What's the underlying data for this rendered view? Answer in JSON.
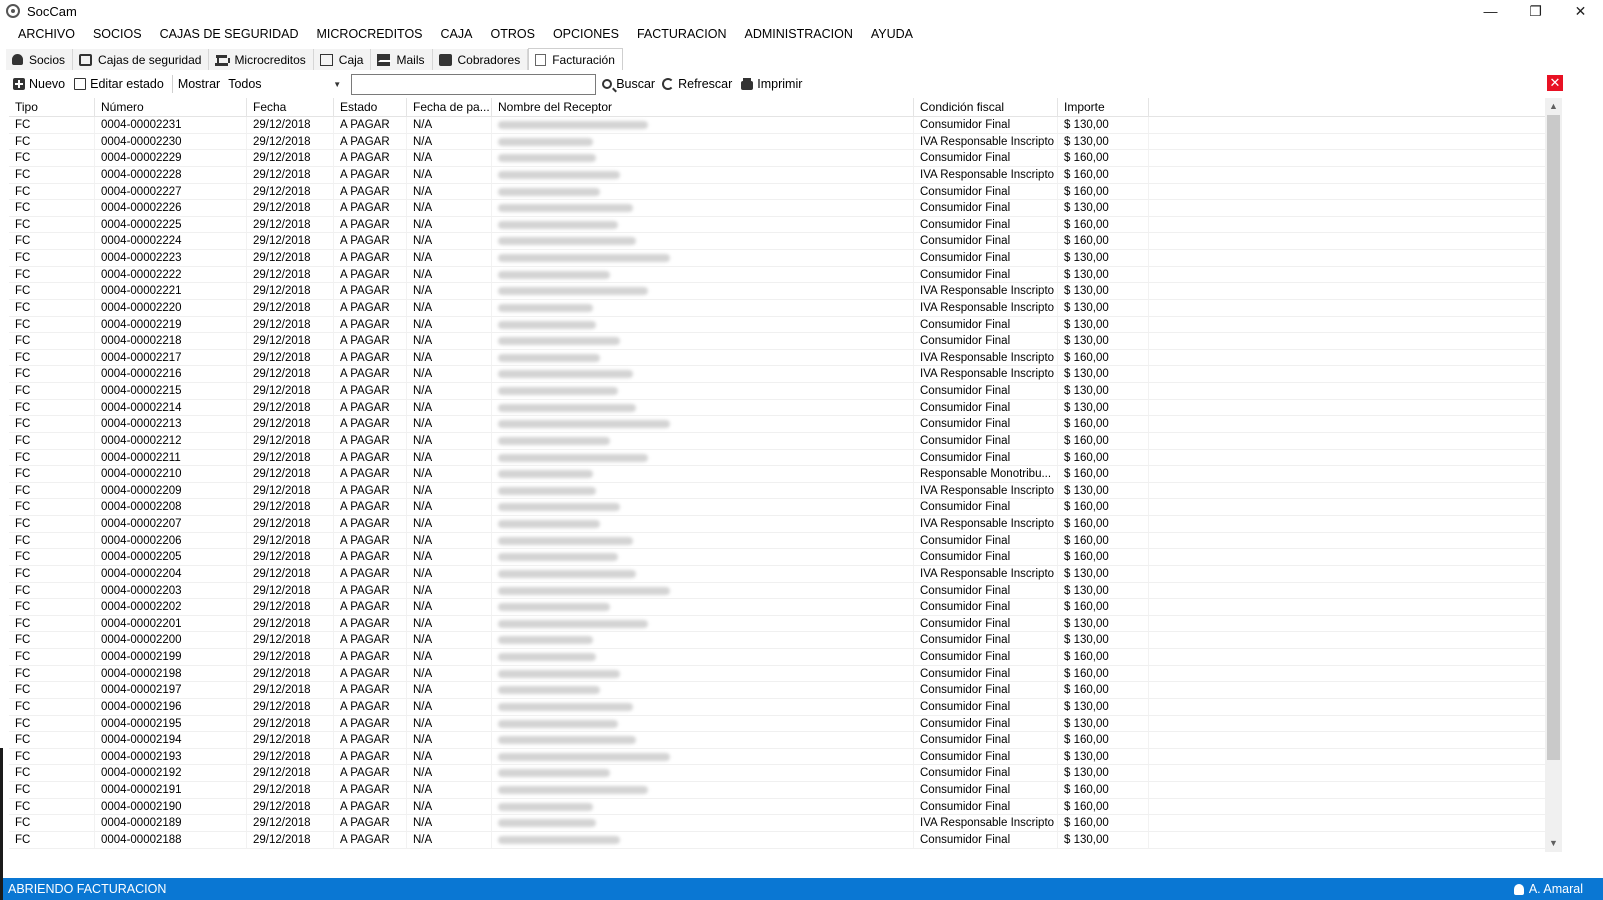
{
  "window": {
    "title": "SocCam",
    "minimize": "—",
    "maximize": "❐",
    "close": "✕"
  },
  "menu": [
    "ARCHIVO",
    "SOCIOS",
    "CAJAS DE SEGURIDAD",
    "MICROCREDITOS",
    "CAJA",
    "OTROS",
    "OPCIONES",
    "FACTURACION",
    "ADMINISTRACION",
    "AYUDA"
  ],
  "tabs": [
    {
      "label": "Socios",
      "icon": "user-icon"
    },
    {
      "label": "Cajas de seguridad",
      "icon": "safe-icon"
    },
    {
      "label": "Microcreditos",
      "icon": "bank-icon"
    },
    {
      "label": "Caja",
      "icon": "cash-icon"
    },
    {
      "label": "Mails",
      "icon": "mail-icon"
    },
    {
      "label": "Cobradores",
      "icon": "briefcase-icon"
    },
    {
      "label": "Facturación",
      "icon": "invoice-icon",
      "active": true
    }
  ],
  "toolbar": {
    "new_label": "Nuevo",
    "edit_state_label": "Editar estado",
    "show_label": "Mostrar",
    "filter_value": "Todos",
    "search_value": "",
    "search_label": "Buscar",
    "refresh_label": "Refrescar",
    "print_label": "Imprimir",
    "close_label": "✕"
  },
  "table": {
    "columns": [
      "Tipo",
      "Número",
      "Fecha",
      "Estado",
      "Fecha de pa...",
      "Nombre del Receptor",
      "Condición fiscal",
      "Importe"
    ],
    "rows": [
      [
        "FC",
        "0004-00002231",
        "29/12/2018",
        "A PAGAR",
        "N/A",
        "",
        "Consumidor Final",
        "$ 130,00"
      ],
      [
        "FC",
        "0004-00002230",
        "29/12/2018",
        "A PAGAR",
        "N/A",
        "",
        "IVA Responsable Inscripto",
        "$ 130,00"
      ],
      [
        "FC",
        "0004-00002229",
        "29/12/2018",
        "A PAGAR",
        "N/A",
        "",
        "Consumidor Final",
        "$ 160,00"
      ],
      [
        "FC",
        "0004-00002228",
        "29/12/2018",
        "A PAGAR",
        "N/A",
        "",
        "IVA Responsable Inscripto",
        "$ 160,00"
      ],
      [
        "FC",
        "0004-00002227",
        "29/12/2018",
        "A PAGAR",
        "N/A",
        "",
        "Consumidor Final",
        "$ 160,00"
      ],
      [
        "FC",
        "0004-00002226",
        "29/12/2018",
        "A PAGAR",
        "N/A",
        "",
        "Consumidor Final",
        "$ 130,00"
      ],
      [
        "FC",
        "0004-00002225",
        "29/12/2018",
        "A PAGAR",
        "N/A",
        "",
        "Consumidor Final",
        "$ 160,00"
      ],
      [
        "FC",
        "0004-00002224",
        "29/12/2018",
        "A PAGAR",
        "N/A",
        "",
        "Consumidor Final",
        "$ 160,00"
      ],
      [
        "FC",
        "0004-00002223",
        "29/12/2018",
        "A PAGAR",
        "N/A",
        "",
        "Consumidor Final",
        "$ 130,00"
      ],
      [
        "FC",
        "0004-00002222",
        "29/12/2018",
        "A PAGAR",
        "N/A",
        "",
        "Consumidor Final",
        "$ 130,00"
      ],
      [
        "FC",
        "0004-00002221",
        "29/12/2018",
        "A PAGAR",
        "N/A",
        "",
        "IVA Responsable Inscripto",
        "$ 130,00"
      ],
      [
        "FC",
        "0004-00002220",
        "29/12/2018",
        "A PAGAR",
        "N/A",
        "",
        "IVA Responsable Inscripto",
        "$ 130,00"
      ],
      [
        "FC",
        "0004-00002219",
        "29/12/2018",
        "A PAGAR",
        "N/A",
        "",
        "Consumidor Final",
        "$ 130,00"
      ],
      [
        "FC",
        "0004-00002218",
        "29/12/2018",
        "A PAGAR",
        "N/A",
        "",
        "Consumidor Final",
        "$ 130,00"
      ],
      [
        "FC",
        "0004-00002217",
        "29/12/2018",
        "A PAGAR",
        "N/A",
        "",
        "IVA Responsable Inscripto",
        "$ 160,00"
      ],
      [
        "FC",
        "0004-00002216",
        "29/12/2018",
        "A PAGAR",
        "N/A",
        "",
        "IVA Responsable Inscripto",
        "$ 130,00"
      ],
      [
        "FC",
        "0004-00002215",
        "29/12/2018",
        "A PAGAR",
        "N/A",
        "",
        "Consumidor Final",
        "$ 130,00"
      ],
      [
        "FC",
        "0004-00002214",
        "29/12/2018",
        "A PAGAR",
        "N/A",
        "",
        "Consumidor Final",
        "$ 130,00"
      ],
      [
        "FC",
        "0004-00002213",
        "29/12/2018",
        "A PAGAR",
        "N/A",
        "",
        "Consumidor Final",
        "$ 160,00"
      ],
      [
        "FC",
        "0004-00002212",
        "29/12/2018",
        "A PAGAR",
        "N/A",
        "",
        "Consumidor Final",
        "$ 160,00"
      ],
      [
        "FC",
        "0004-00002211",
        "29/12/2018",
        "A PAGAR",
        "N/A",
        "",
        "Consumidor Final",
        "$ 160,00"
      ],
      [
        "FC",
        "0004-00002210",
        "29/12/2018",
        "A PAGAR",
        "N/A",
        "",
        "Responsable Monotribu...",
        "$ 160,00"
      ],
      [
        "FC",
        "0004-00002209",
        "29/12/2018",
        "A PAGAR",
        "N/A",
        "",
        "IVA Responsable Inscripto",
        "$ 130,00"
      ],
      [
        "FC",
        "0004-00002208",
        "29/12/2018",
        "A PAGAR",
        "N/A",
        "",
        "Consumidor Final",
        "$ 160,00"
      ],
      [
        "FC",
        "0004-00002207",
        "29/12/2018",
        "A PAGAR",
        "N/A",
        "",
        "IVA Responsable Inscripto",
        "$ 160,00"
      ],
      [
        "FC",
        "0004-00002206",
        "29/12/2018",
        "A PAGAR",
        "N/A",
        "",
        "Consumidor Final",
        "$ 160,00"
      ],
      [
        "FC",
        "0004-00002205",
        "29/12/2018",
        "A PAGAR",
        "N/A",
        "",
        "Consumidor Final",
        "$ 160,00"
      ],
      [
        "FC",
        "0004-00002204",
        "29/12/2018",
        "A PAGAR",
        "N/A",
        "",
        "IVA Responsable Inscripto",
        "$ 130,00"
      ],
      [
        "FC",
        "0004-00002203",
        "29/12/2018",
        "A PAGAR",
        "N/A",
        "",
        "Consumidor Final",
        "$ 130,00"
      ],
      [
        "FC",
        "0004-00002202",
        "29/12/2018",
        "A PAGAR",
        "N/A",
        "",
        "Consumidor Final",
        "$ 160,00"
      ],
      [
        "FC",
        "0004-00002201",
        "29/12/2018",
        "A PAGAR",
        "N/A",
        "",
        "Consumidor Final",
        "$ 130,00"
      ],
      [
        "FC",
        "0004-00002200",
        "29/12/2018",
        "A PAGAR",
        "N/A",
        "",
        "Consumidor Final",
        "$ 130,00"
      ],
      [
        "FC",
        "0004-00002199",
        "29/12/2018",
        "A PAGAR",
        "N/A",
        "",
        "Consumidor Final",
        "$ 160,00"
      ],
      [
        "FC",
        "0004-00002198",
        "29/12/2018",
        "A PAGAR",
        "N/A",
        "",
        "Consumidor Final",
        "$ 160,00"
      ],
      [
        "FC",
        "0004-00002197",
        "29/12/2018",
        "A PAGAR",
        "N/A",
        "",
        "Consumidor Final",
        "$ 160,00"
      ],
      [
        "FC",
        "0004-00002196",
        "29/12/2018",
        "A PAGAR",
        "N/A",
        "",
        "Consumidor Final",
        "$ 130,00"
      ],
      [
        "FC",
        "0004-00002195",
        "29/12/2018",
        "A PAGAR",
        "N/A",
        "",
        "Consumidor Final",
        "$ 130,00"
      ],
      [
        "FC",
        "0004-00002194",
        "29/12/2018",
        "A PAGAR",
        "N/A",
        "",
        "Consumidor Final",
        "$ 160,00"
      ],
      [
        "FC",
        "0004-00002193",
        "29/12/2018",
        "A PAGAR",
        "N/A",
        "",
        "Consumidor Final",
        "$ 130,00"
      ],
      [
        "FC",
        "0004-00002192",
        "29/12/2018",
        "A PAGAR",
        "N/A",
        "",
        "Consumidor Final",
        "$ 130,00"
      ],
      [
        "FC",
        "0004-00002191",
        "29/12/2018",
        "A PAGAR",
        "N/A",
        "",
        "Consumidor Final",
        "$ 160,00"
      ],
      [
        "FC",
        "0004-00002190",
        "29/12/2018",
        "A PAGAR",
        "N/A",
        "",
        "Consumidor Final",
        "$ 160,00"
      ],
      [
        "FC",
        "0004-00002189",
        "29/12/2018",
        "A PAGAR",
        "N/A",
        "",
        "IVA Responsable Inscripto",
        "$ 160,00"
      ],
      [
        "FC",
        "0004-00002188",
        "29/12/2018",
        "A PAGAR",
        "N/A",
        "",
        "Consumidor Final",
        "$ 130,00"
      ]
    ]
  },
  "scrollbar": {
    "up": "▲",
    "down": "▼"
  },
  "status": {
    "message": "ABRIENDO FACTURACION",
    "user": "A. Amaral"
  }
}
